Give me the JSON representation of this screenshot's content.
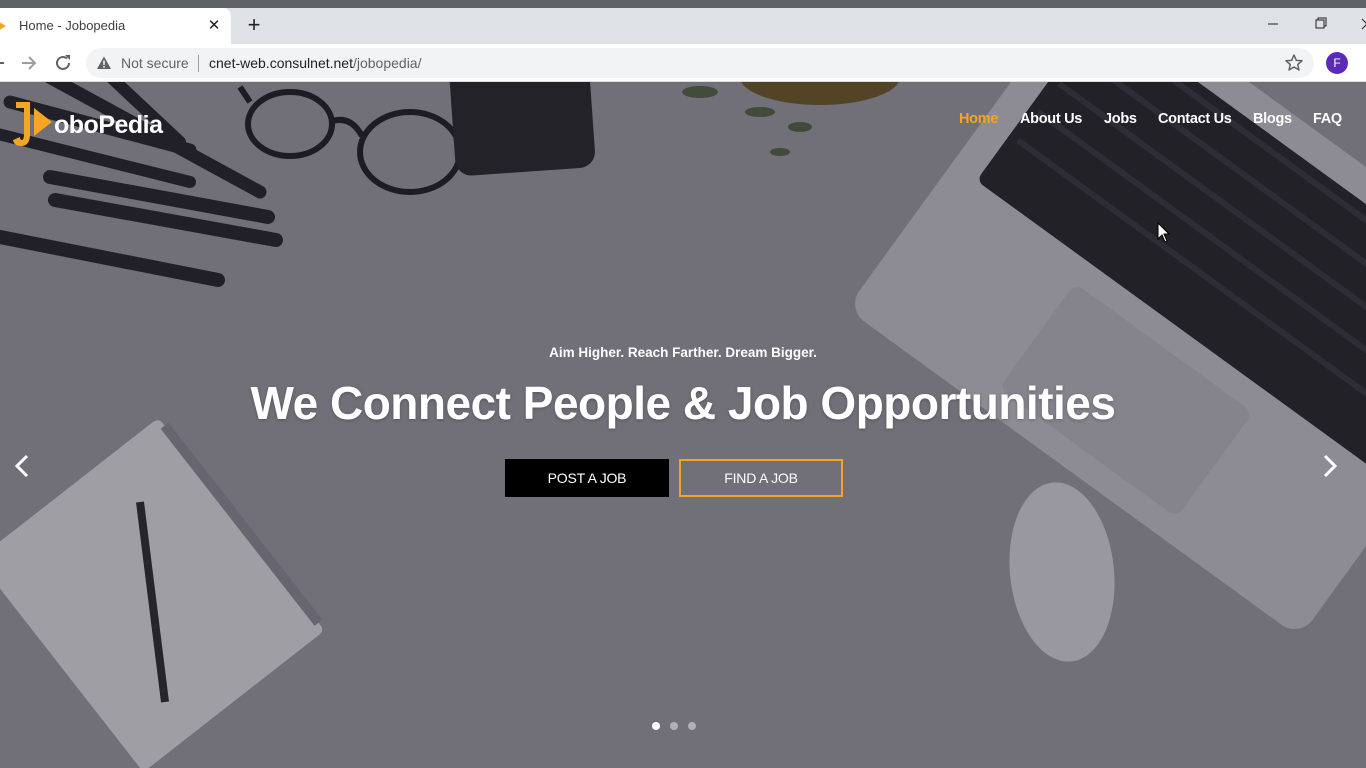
{
  "browser": {
    "tab_title": "Home - Jobopedia",
    "new_tab_label": "+",
    "close_label": "✕",
    "security_text": "Not secure",
    "url_host": "cnet-web.consulnet.net",
    "url_path": "/jobopedia/",
    "profile_initial": "F"
  },
  "site": {
    "logo_text": "oboPedia",
    "nav": [
      {
        "label": "Home",
        "active": true
      },
      {
        "label": "About Us"
      },
      {
        "label": "Jobs"
      },
      {
        "label": "Contact Us"
      },
      {
        "label": "Blogs"
      },
      {
        "label": "FAQ"
      }
    ]
  },
  "hero": {
    "tagline": "Aim Higher. Reach Farther. Dream Bigger.",
    "headline": "We Connect People & Job Opportunities",
    "primary_button": "POST A JOB",
    "secondary_button": "FIND A JOB",
    "slides": {
      "count": 3,
      "active": 1
    }
  },
  "colors": {
    "accent": "#f5a524",
    "primary_button_bg": "#000000",
    "profile_avatar": "#5b2bb8"
  }
}
